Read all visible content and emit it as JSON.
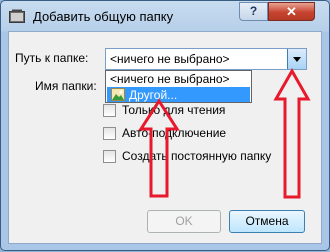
{
  "window": {
    "title": "Добавить общую папку",
    "help_label": "?",
    "close_label": "✕"
  },
  "form": {
    "path_label": "Путь к папке:",
    "path_value": "<ничего не выбрано>",
    "name_label": "Имя папки:",
    "dropdown_options": [
      "<ничего не выбрано>",
      "Другой..."
    ],
    "readonly_label": "Только для чтения",
    "automount_label": "Авто-подключение",
    "permanent_label": "Создать постоянную папку"
  },
  "buttons": {
    "ok_label": "OK",
    "cancel_label": "Отмена"
  },
  "annotations": {
    "arrow_color": "#e8192c"
  },
  "icons": {
    "app": "virtualbox-folder-icon",
    "combo_arrow": "chevron-down-icon",
    "other_option": "picture-folder-icon"
  }
}
